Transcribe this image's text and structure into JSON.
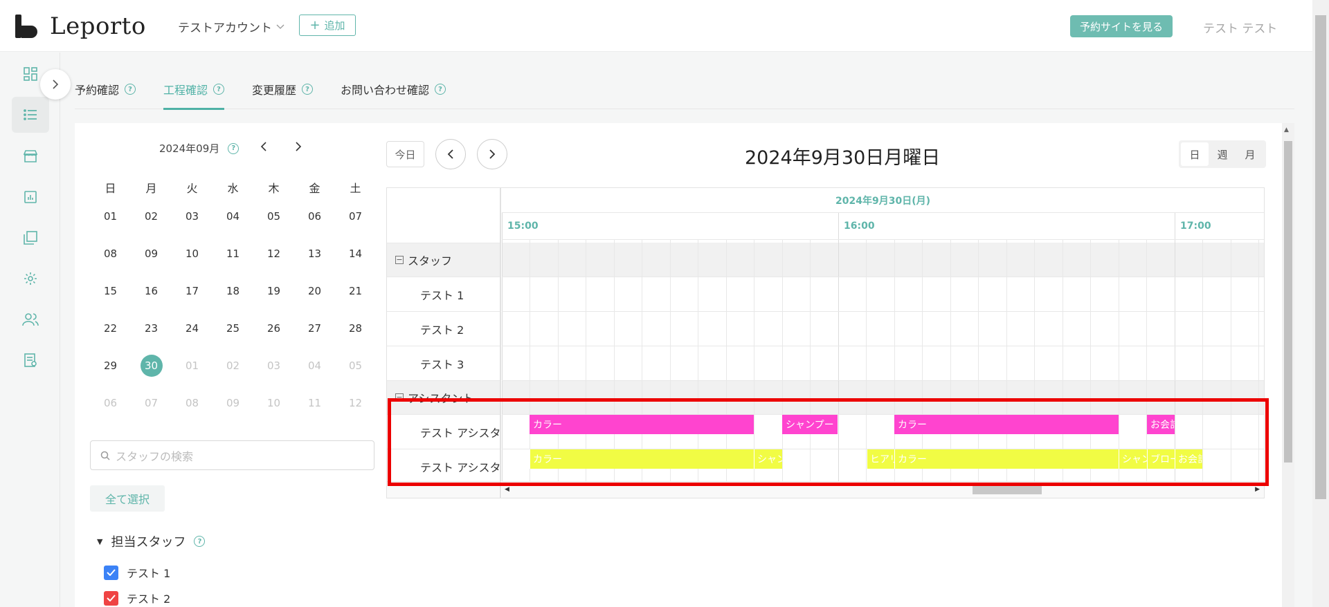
{
  "app": {
    "logo_text": "Leporto",
    "account": "テストアカウント",
    "add_label": "追加",
    "reserve_site": "予約サイトを見る",
    "user_name": "テスト テスト"
  },
  "tabs": [
    {
      "label": "予約確認"
    },
    {
      "label": "工程確認"
    },
    {
      "label": "変更履歴"
    },
    {
      "label": "お問い合わせ確認"
    }
  ],
  "mini_calendar": {
    "month_label": "2024年09月",
    "weekdays": [
      "日",
      "月",
      "火",
      "水",
      "木",
      "金",
      "土"
    ],
    "weeks": [
      [
        "01",
        "02",
        "03",
        "04",
        "05",
        "06",
        "07"
      ],
      [
        "08",
        "09",
        "10",
        "11",
        "12",
        "13",
        "14"
      ],
      [
        "15",
        "16",
        "17",
        "18",
        "19",
        "20",
        "21"
      ],
      [
        "22",
        "23",
        "24",
        "25",
        "26",
        "27",
        "28"
      ],
      [
        "29",
        "30",
        "01",
        "02",
        "03",
        "04",
        "05"
      ],
      [
        "06",
        "07",
        "08",
        "09",
        "10",
        "11",
        "12"
      ]
    ],
    "selected": "30"
  },
  "search": {
    "placeholder": "スタッフの検索"
  },
  "select_all": "全て選択",
  "staff_filter": {
    "title": "担当スタッフ",
    "items": [
      {
        "label": "テスト 1",
        "color": "#3b82f6"
      },
      {
        "label": "テスト 2",
        "color": "#ef4444"
      }
    ]
  },
  "calendar": {
    "today_label": "今日",
    "title": "2024年9月30日月曜日",
    "views": [
      "日",
      "週",
      "月"
    ],
    "date_header": "2024年9月30日(月)",
    "times": [
      "15:00",
      "16:00",
      "17:00"
    ],
    "groups": [
      {
        "label": "スタッフ",
        "rows": [
          "テスト 1",
          "テスト 2",
          "テスト 3"
        ]
      },
      {
        "label": "アシスタント",
        "rows": [
          "テスト アシスタ",
          "テスト アシスタ"
        ]
      }
    ],
    "events_row1": [
      "カラー",
      "シャンプー",
      "カラー",
      "お会計"
    ],
    "events_row2": [
      "カラー",
      "シャン",
      "ヒアリ",
      "カラー",
      "シャン",
      "ブロー",
      "お会計"
    ]
  },
  "colors": {
    "accent": "#5fb5aa",
    "event_magenta": "#ff44cf",
    "event_yellow": "#f1fc44",
    "highlight": "#ec0000"
  }
}
